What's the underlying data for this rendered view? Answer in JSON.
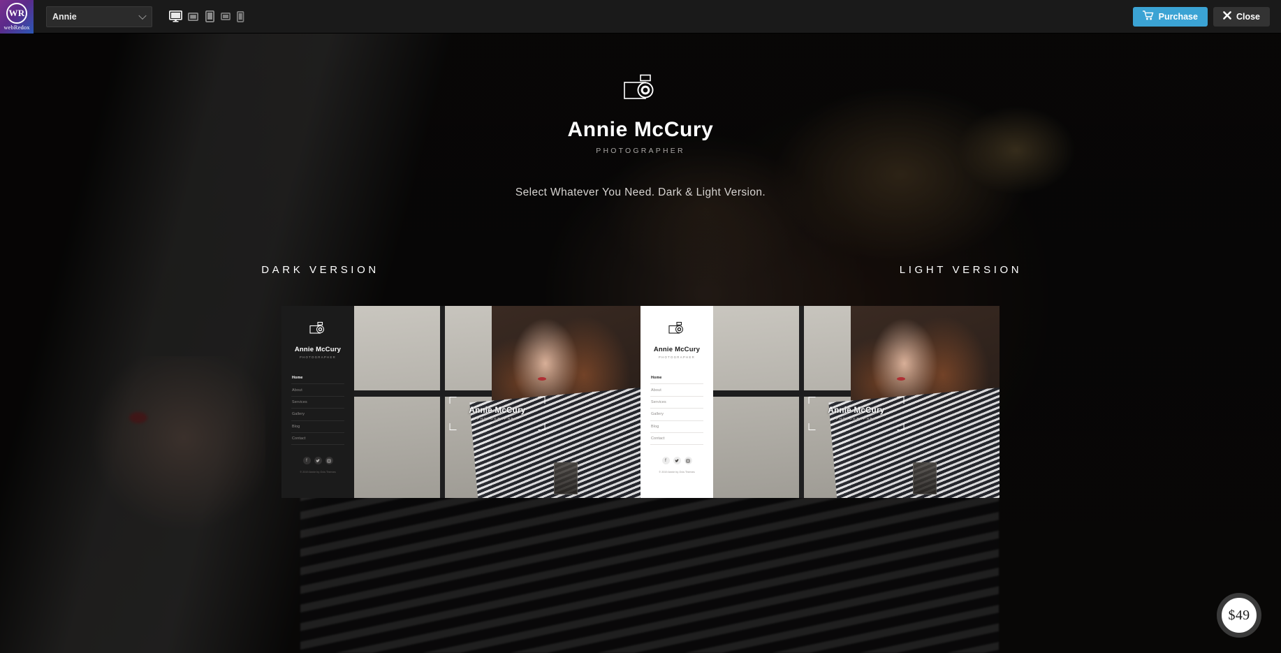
{
  "toolbar": {
    "brand": {
      "mark": "WR",
      "word": "webRedox"
    },
    "theme_select": {
      "value": "Annie",
      "icon": "chevron-down-icon"
    },
    "devices": [
      {
        "name": "desktop",
        "label": "Desktop",
        "active": true
      },
      {
        "name": "laptop",
        "label": "Laptop",
        "active": false
      },
      {
        "name": "tablet-portrait",
        "label": "Tablet Portrait",
        "active": false
      },
      {
        "name": "tablet-landscape",
        "label": "Tablet Landscape",
        "active": false
      },
      {
        "name": "mobile",
        "label": "Mobile",
        "active": false
      }
    ],
    "purchase_label": "Purchase",
    "close_label": "Close",
    "purchase_color": "#3ba3d4",
    "close_color": "#333333"
  },
  "hero": {
    "logo_icon": "camera-icon",
    "title": "Annie McCury",
    "subtitle": "PHOTOGRAPHER",
    "tagline": "Select Whatever You Need. Dark & Light Version."
  },
  "versions": [
    {
      "label": "DARK VERSION",
      "mode": "dark"
    },
    {
      "label": "LIGHT VERSION",
      "mode": "light"
    }
  ],
  "preview": {
    "logo_icon": "camera-icon",
    "title": "Annie McCury",
    "subtitle": "PHOTOGRAPHER",
    "nav": [
      {
        "label": "Home",
        "active": true
      },
      {
        "label": "About",
        "active": false
      },
      {
        "label": "Services",
        "active": false
      },
      {
        "label": "Gallery",
        "active": false
      },
      {
        "label": "Blog",
        "active": false
      },
      {
        "label": "Contact",
        "active": false
      }
    ],
    "social": [
      {
        "icon": "facebook-icon",
        "glyph": "f"
      },
      {
        "icon": "twitter-icon",
        "glyph": "✒"
      },
      {
        "icon": "instagram-icon",
        "glyph": "□"
      }
    ],
    "copyright": "© 2019 Annie by Ovis Themes",
    "overlay_title": "Annie McCury",
    "overlay_subtitle": "PHOTOGRAPHER"
  },
  "price_badge": {
    "amount": "$49"
  }
}
